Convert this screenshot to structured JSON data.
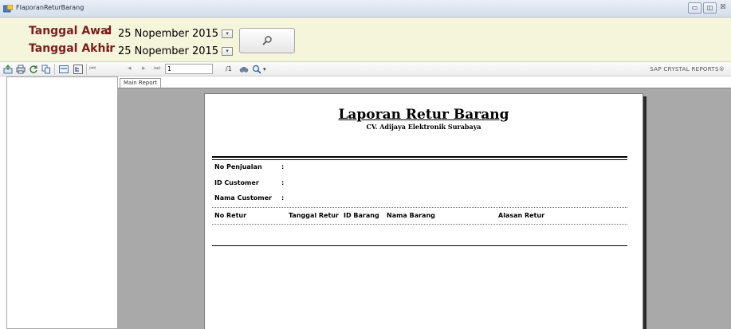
{
  "window": {
    "title": "FlaporanReturBarang"
  },
  "params": {
    "start_label": "Tanggal Awal",
    "end_label": "Tanggal Akhir",
    "colon": ":",
    "start_date": "25 Nopember 2015",
    "end_date": "25 Nopember 2015"
  },
  "toolbar": {
    "page_number": "1",
    "page_total": "/1",
    "brand": "SAP CRYSTAL REPORTS®"
  },
  "tabs": [
    "Main Report"
  ],
  "report": {
    "title": "Laporan Retur Barang",
    "subtitle": "CV. Adijaya Elektronik Surabaya",
    "fields": [
      {
        "label": "No Penjualan",
        "colon": ":"
      },
      {
        "label": "ID Customer",
        "colon": ":"
      },
      {
        "label": "Nama Customer",
        "colon": ":"
      }
    ],
    "columns": [
      "No Retur",
      "Tanggal Retur",
      "ID Barang",
      "Nama Barang",
      "Alasan Retur"
    ]
  }
}
